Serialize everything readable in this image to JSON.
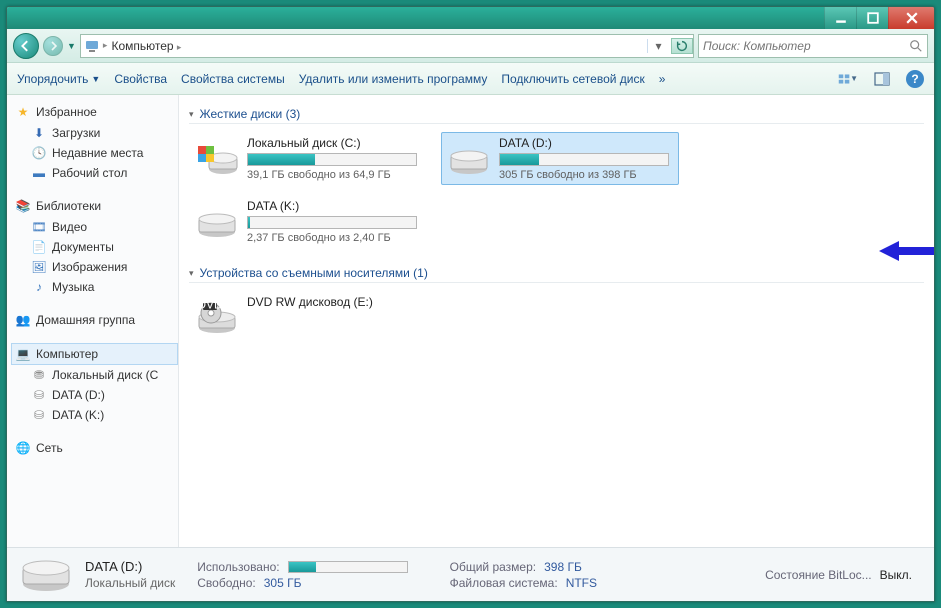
{
  "window": {
    "min": "_",
    "max": "▢",
    "close": "✕"
  },
  "address": {
    "path_label": "Компьютер",
    "sep": "▸"
  },
  "search": {
    "placeholder": "Поиск: Компьютер"
  },
  "toolbar": {
    "organize": "Упорядочить",
    "properties": "Свойства",
    "sys_props": "Свойства системы",
    "uninstall": "Удалить или изменить программу",
    "map_net": "Подключить сетевой диск",
    "more": "»"
  },
  "sidebar": {
    "favorites": "Избранное",
    "downloads": "Загрузки",
    "recent": "Недавние места",
    "desktop": "Рабочий стол",
    "libraries": "Библиотеки",
    "video": "Видео",
    "documents": "Документы",
    "images": "Изображения",
    "music": "Музыка",
    "homegroup": "Домашняя группа",
    "computer": "Компьютер",
    "local_c": "Локальный диск (С",
    "data_d": "DATA (D:)",
    "data_k": "DATA (K:)",
    "network": "Сеть"
  },
  "groups": {
    "hdd": "Жесткие диски (3)",
    "removable": "Устройства со съемными носителями (1)"
  },
  "drives": [
    {
      "name": "Локальный диск (C:)",
      "free": "39,1 ГБ свободно из 64,9 ГБ",
      "fill": 40,
      "selected": false,
      "icon": "win"
    },
    {
      "name": "DATA (D:)",
      "free": "305 ГБ свободно из 398 ГБ",
      "fill": 23,
      "selected": true,
      "icon": "hdd"
    },
    {
      "name": "DATA (K:)",
      "free": "2,37 ГБ свободно из 2,40 ГБ",
      "fill": 1,
      "selected": false,
      "icon": "hdd"
    }
  ],
  "removable": [
    {
      "name": "DVD RW дисковод (E:)"
    }
  ],
  "status": {
    "name": "DATA (D:)",
    "type": "Локальный диск",
    "used_lbl": "Использовано:",
    "free_lbl": "Свободно:",
    "free_val": "305 ГБ",
    "total_lbl": "Общий размер:",
    "total_val": "398 ГБ",
    "fs_lbl": "Файловая система:",
    "fs_val": "NTFS",
    "bitlocker_lbl": "Состояние BitLoc...",
    "bitlocker_val": "Выкл.",
    "fill": 23
  }
}
